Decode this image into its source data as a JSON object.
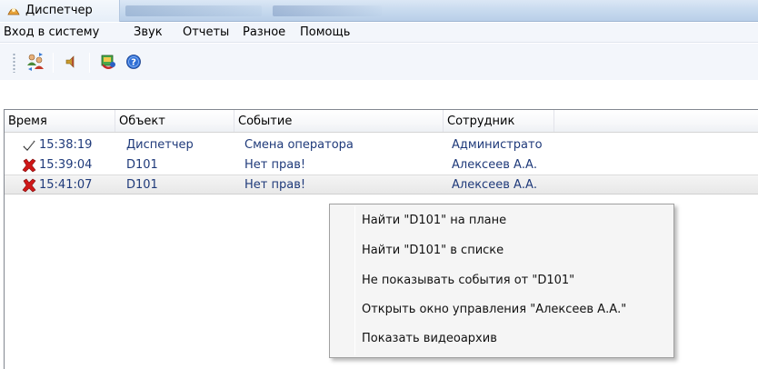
{
  "window": {
    "title": "Диспетчер"
  },
  "menu": {
    "items": [
      "Вход в систему",
      "Звук",
      "Отчеты",
      "Разное",
      "Помощь"
    ]
  },
  "toolbar": {
    "buttons": [
      "users-switch-icon",
      "speaker-icon",
      "map-icon",
      "help-icon"
    ]
  },
  "table": {
    "columns": [
      "Время",
      "Объект",
      "Событие",
      "Сотрудник"
    ],
    "rows": [
      {
        "status_icon": "checkmark-icon",
        "time": "15:38:19",
        "object": "Диспетчер",
        "event": "Смена оператора",
        "employee": "Администрато"
      },
      {
        "status_icon": "red-x-icon",
        "time": "15:39:04",
        "object": "D101",
        "event": "Нет прав!",
        "employee": "Алексеев А.А."
      },
      {
        "status_icon": "red-x-icon",
        "time": "15:41:07",
        "object": "D101",
        "event": "Нет прав!",
        "employee": "Алексеев А.А.",
        "selected": true
      }
    ]
  },
  "context_menu": {
    "items": [
      "Найти \"D101\" на плане",
      "Найти \"D101\" в списке",
      "Не показывать события от \"D101\"",
      "Открыть окно управления \"Алексеев А.А.\"",
      "Показать видеоархив"
    ]
  },
  "colors": {
    "cell_text": "#1f3a7a",
    "error_icon": "#d01818",
    "titlebar": "#c9dbef"
  }
}
